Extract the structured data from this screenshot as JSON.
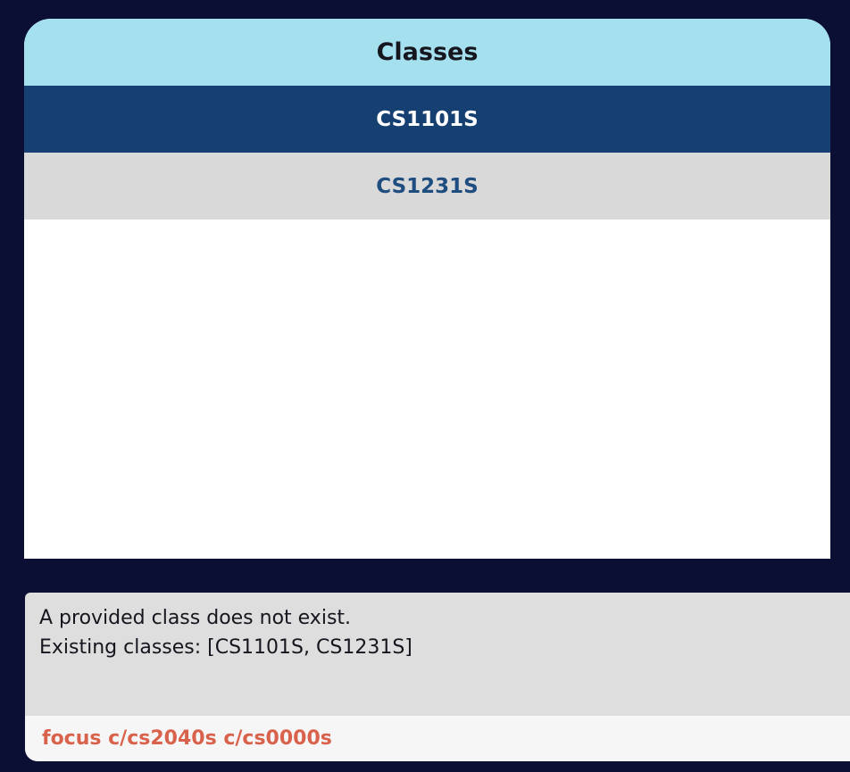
{
  "classes_panel": {
    "title": "Classes",
    "items": [
      {
        "label": "CS1101S",
        "selected": true
      },
      {
        "label": "CS1231S",
        "selected": false
      }
    ]
  },
  "result": {
    "lines": [
      "A provided class does not exist.",
      "Existing classes: [CS1101S, CS1231S]"
    ]
  },
  "command": {
    "value": "focus c/cs2040s c/cs0000s"
  },
  "colors": {
    "background": "#0a0f33",
    "header": "#a5e0ef",
    "selected_row": "#163f72",
    "unselected_row": "#d9d9d9",
    "command_text": "#d9624c"
  }
}
